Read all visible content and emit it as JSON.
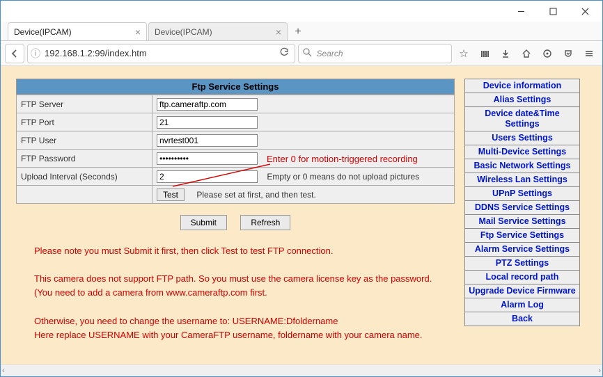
{
  "browser": {
    "tabs": [
      {
        "title": "Device(IPCAM)"
      },
      {
        "title": "Device(IPCAM)"
      }
    ],
    "url": "192.168.1.2:99/index.htm",
    "search_placeholder": "Search"
  },
  "page": {
    "header": "Ftp Service Settings",
    "fields": {
      "ftp_server_label": "FTP Server",
      "ftp_server_value": "ftp.cameraftp.com",
      "ftp_port_label": "FTP Port",
      "ftp_port_value": "21",
      "ftp_user_label": "FTP User",
      "ftp_user_value": "nvrtest001",
      "ftp_password_label": "FTP Password",
      "ftp_password_value": "••••••••••",
      "upload_interval_label": "Upload Interval (Seconds)",
      "upload_interval_value": "2",
      "upload_interval_hint": "Empty or 0 means do not upload pictures",
      "test_button": "Test",
      "test_hint": "Please set at first, and then test."
    },
    "buttons": {
      "submit": "Submit",
      "refresh": "Refresh"
    },
    "annotation": "Enter 0 for motion-triggered recording",
    "notes": {
      "n1": "Please note you must Submit it first, then click Test to test FTP connection.",
      "n2": "This camera does not support FTP path. So you must use the camera license key as the password. (You need to add a camera from  www.cameraftp.com first.",
      "n3": "Otherwise, you need to change the username to:   USERNAME:Dfoldername",
      "n4": "Here replace USERNAME with your CameraFTP username, foldername with your camera name."
    }
  },
  "sidebar": {
    "items": [
      "Device information",
      "Alias Settings",
      "Device date&Time Settings",
      "Users Settings",
      "Multi-Device Settings",
      "Basic Network Settings",
      "Wireless Lan Settings",
      "UPnP Settings",
      "DDNS Service Settings",
      "Mail Service Settings",
      "Ftp Service Settings",
      "Alarm Service Settings",
      "PTZ Settings",
      "Local record path",
      "Upgrade Device Firmware",
      "Alarm Log",
      "Back"
    ]
  }
}
